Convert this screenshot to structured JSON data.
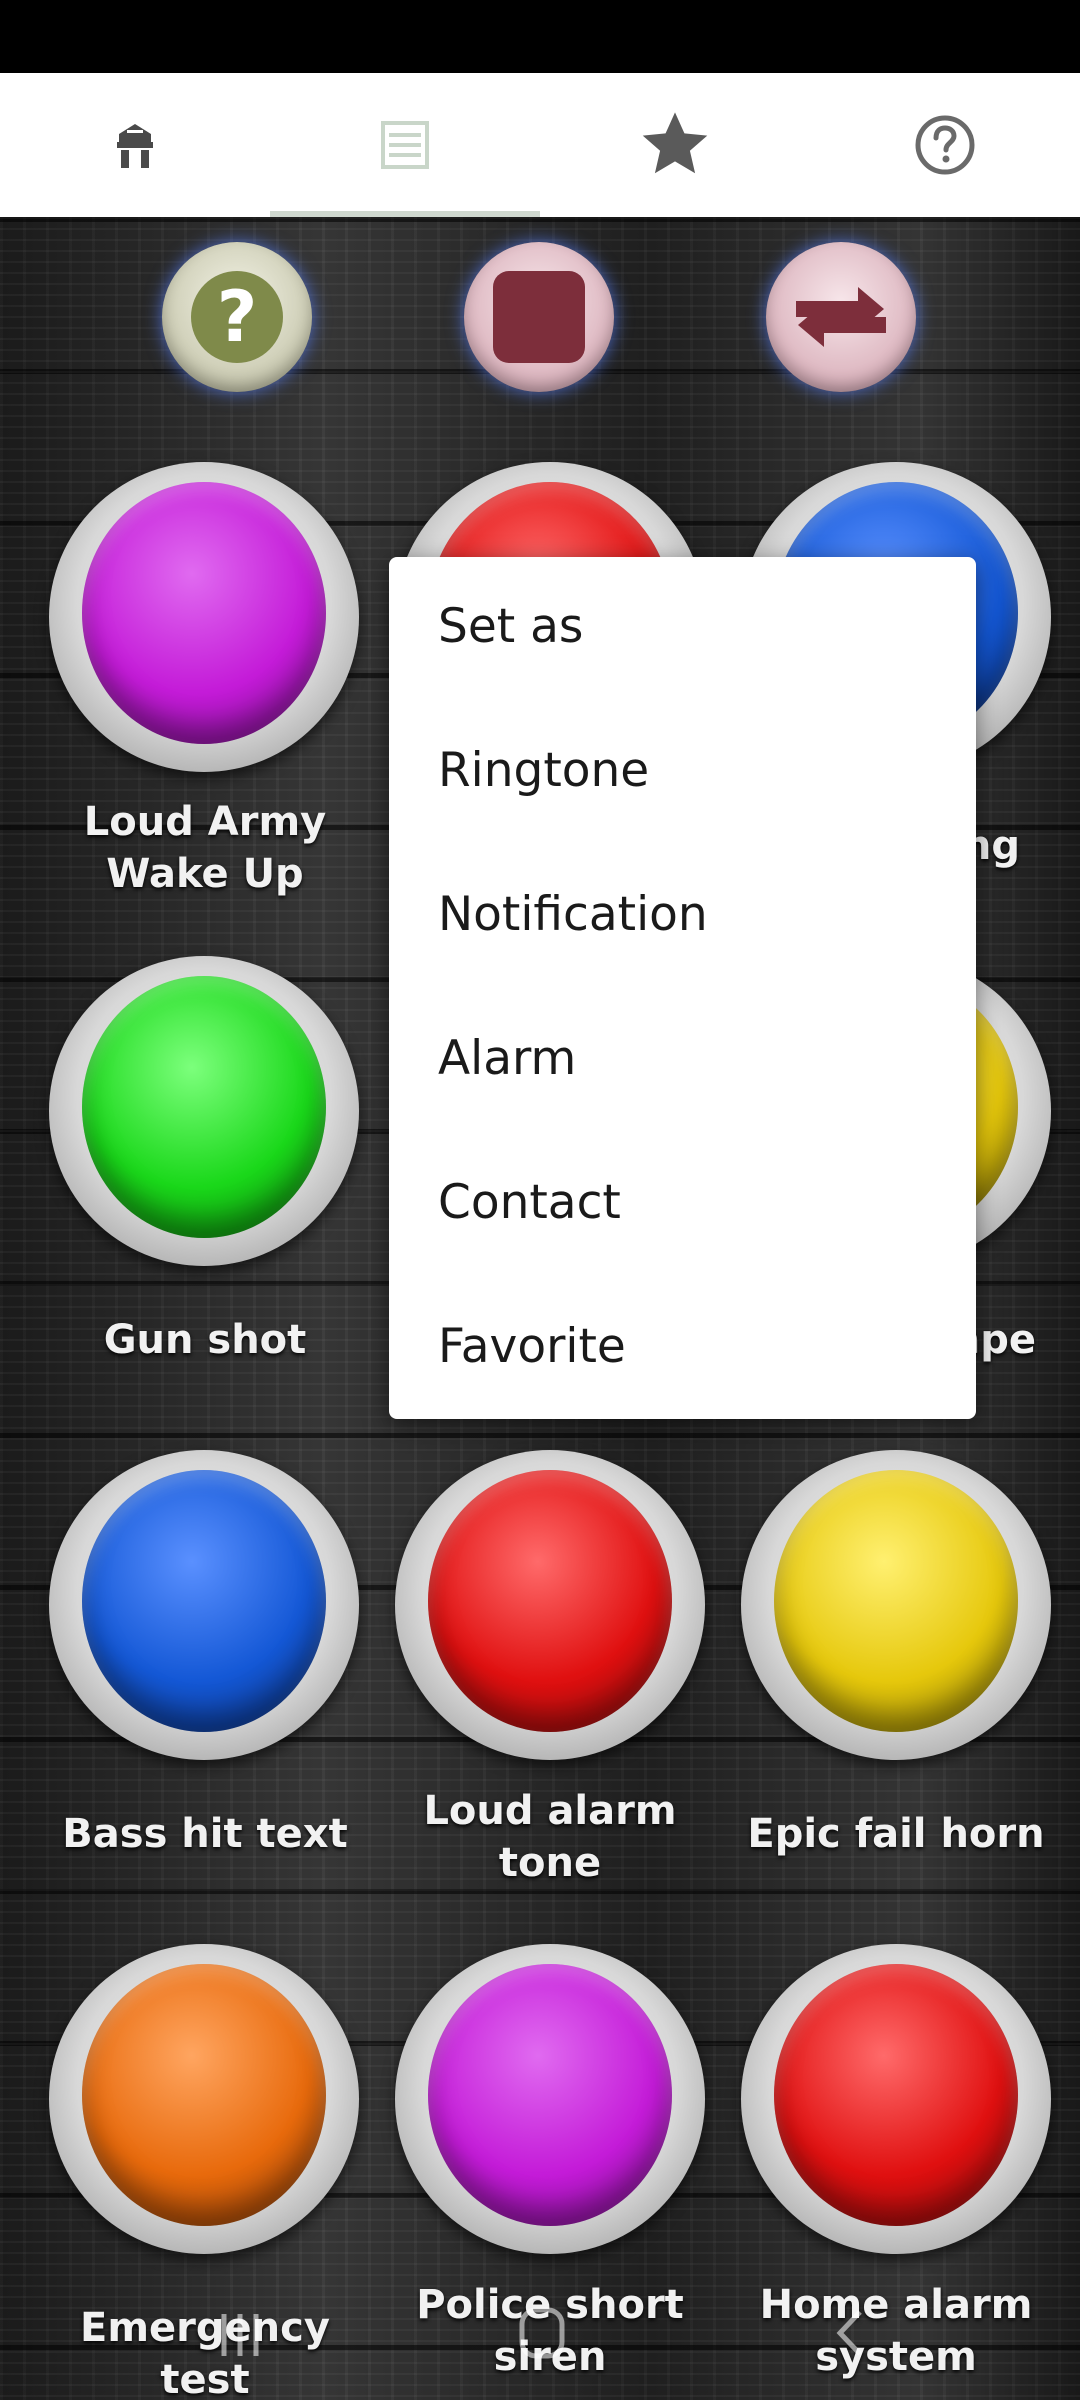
{
  "tabs": [
    {
      "icon": "soldier-icon",
      "active": false
    },
    {
      "icon": "list-icon",
      "active": true
    },
    {
      "icon": "star-icon",
      "active": false
    },
    {
      "icon": "help-icon",
      "active": false
    }
  ],
  "controls": [
    {
      "icon": "help-icon",
      "glyph": "?"
    },
    {
      "icon": "stop-icon"
    },
    {
      "icon": "repeat-icon"
    }
  ],
  "sounds": [
    {
      "label": "Loud Army Wake Up",
      "color": "#c41bd8"
    },
    {
      "label": "",
      "color": "#e01010"
    },
    {
      "label": "ng",
      "color": "#1458d6"
    },
    {
      "label": "Gun shot",
      "color": "#1ad81a"
    },
    {
      "label": "",
      "color": ""
    },
    {
      "label": "ape",
      "color": "#e6c80c"
    },
    {
      "label": "Bass hit text",
      "color": "#1458d6"
    },
    {
      "label": "Loud alarm tone",
      "color": "#e01010"
    },
    {
      "label": "Epic fail horn",
      "color": "#e6c80c"
    },
    {
      "label": "Emergency test",
      "color": "#e86a0c"
    },
    {
      "label": "Police short siren",
      "color": "#c41bd8"
    },
    {
      "label": "Home alarm system",
      "color": "#e01010"
    }
  ],
  "menu": {
    "title": "Set as",
    "items": [
      "Ringtone",
      "Notification",
      "Alarm",
      "Contact",
      "Favorite"
    ]
  },
  "colors": {
    "status_bar": "#000000",
    "tab_bar": "#ffffff",
    "tab_active_indicator": "#cfd8cf",
    "menu_bg": "#ffffff"
  }
}
